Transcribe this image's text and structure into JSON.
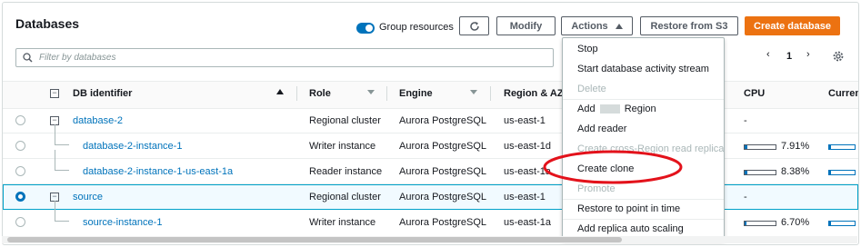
{
  "header": {
    "title": "Databases",
    "group_resources_label": "Group resources",
    "group_resources_on": true,
    "refresh_icon": "refresh-icon",
    "modify_label": "Modify",
    "actions_label": "Actions",
    "restore_s3_label": "Restore from S3",
    "create_database_label": "Create database"
  },
  "filter": {
    "placeholder": "Filter by databases",
    "icon": "search-icon"
  },
  "pager": {
    "prev": "‹",
    "page": "1",
    "next": "›",
    "settings_icon": "gear-icon"
  },
  "columns": {
    "db_identifier": "DB identifier",
    "role": "Role",
    "engine": "Engine",
    "region_az": "Region & AZ",
    "cpu": "CPU",
    "current": "Curren"
  },
  "rows": [
    {
      "id": "database-2",
      "role": "Regional cluster",
      "engine": "Aurora PostgreSQL",
      "region": "us-east-1",
      "cpu": "-",
      "cpu_percent": null,
      "selected": false
    },
    {
      "id": "database-2-instance-1",
      "role": "Writer instance",
      "engine": "Aurora PostgreSQL",
      "region": "us-east-1d",
      "cpu": "7.91%",
      "cpu_percent": 7.91,
      "selected": false
    },
    {
      "id": "database-2-instance-1-us-east-1a",
      "role": "Reader instance",
      "engine": "Aurora PostgreSQL",
      "region": "us-east-1a",
      "cpu": "8.38%",
      "cpu_percent": 8.38,
      "selected": false
    },
    {
      "id": "source",
      "role": "Regional cluster",
      "engine": "Aurora PostgreSQL",
      "region": "us-east-1",
      "cpu": "-",
      "cpu_percent": null,
      "selected": true
    },
    {
      "id": "source-instance-1",
      "role": "Writer instance",
      "engine": "Aurora PostgreSQL",
      "region": "us-east-1a",
      "cpu": "6.70%",
      "cpu_percent": 6.7,
      "selected": false
    }
  ],
  "actions_menu": [
    {
      "label": "Stop",
      "enabled": true
    },
    {
      "label": "Start database activity stream",
      "enabled": true
    },
    {
      "label": "Delete",
      "enabled": false
    },
    {
      "label_prefix": "Add",
      "label_suffix": "Region",
      "enabled": true
    },
    {
      "label": "Add reader",
      "enabled": true
    },
    {
      "label": "Create cross-Region read replica",
      "enabled": false
    },
    {
      "label": "Create clone",
      "enabled": true
    },
    {
      "label": "Promote",
      "enabled": false
    },
    {
      "label": "Restore to point in time",
      "enabled": true
    },
    {
      "label": "Add replica auto scaling",
      "enabled": true
    }
  ],
  "colors": {
    "accent": "#0073bb",
    "primary_button": "#ec7211",
    "annotation": "#e3121b"
  }
}
